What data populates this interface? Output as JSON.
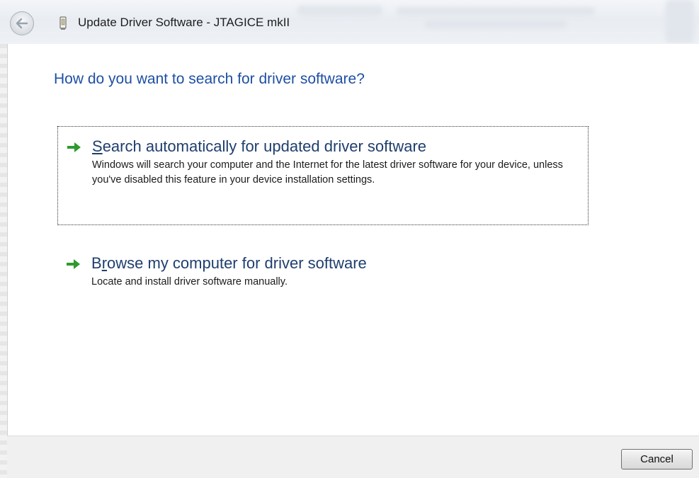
{
  "window": {
    "title": "Update Driver Software - JTAGICE mkII",
    "back_icon": "back-arrow-icon",
    "app_icon": "usb-device-icon"
  },
  "main": {
    "heading": "How do you want to search for driver software?",
    "options": [
      {
        "title_mnemonic": "S",
        "title_rest": "earch automatically for updated driver software",
        "description": "Windows will search your computer and the Internet for the latest driver software for your device, unless you've disabled this feature in your device installation settings.",
        "icon": "green-arrow-icon",
        "focused": true
      },
      {
        "title_prefix": "B",
        "title_mnemonic": "r",
        "title_rest": "owse my computer for driver software",
        "description": "Locate and install driver software manually.",
        "icon": "green-arrow-icon",
        "focused": false
      }
    ]
  },
  "footer": {
    "cancel_label": "Cancel"
  },
  "colors": {
    "heading": "#1e4fa3",
    "option_title": "#1f3e6e",
    "arrow_green": "#2e9a2e"
  }
}
